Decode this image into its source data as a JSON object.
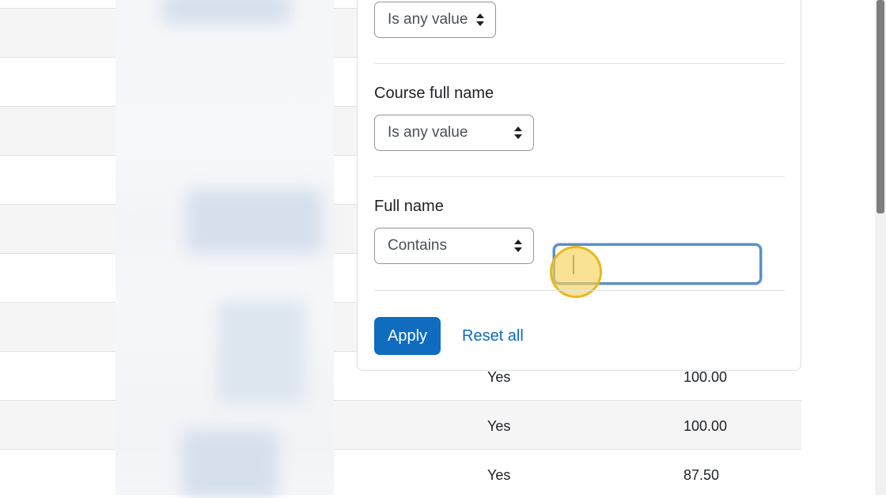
{
  "table": {
    "rows": [
      {
        "status": "",
        "grade": ""
      },
      {
        "status": "",
        "grade": ""
      },
      {
        "status": "",
        "grade": ""
      },
      {
        "status": "",
        "grade": ""
      },
      {
        "status": "",
        "grade": ""
      },
      {
        "status": "",
        "grade": ""
      },
      {
        "status": "",
        "grade": ""
      },
      {
        "status": "Yes",
        "grade": "100.00"
      },
      {
        "status": "Yes",
        "grade": "100.00"
      },
      {
        "status": "Yes",
        "grade": "87.50"
      }
    ]
  },
  "filters": {
    "first": {
      "select_value": "Is any value"
    },
    "course_full_name": {
      "label": "Course full name",
      "select_value": "Is any value"
    },
    "full_name": {
      "label": "Full name",
      "select_value": "Contains",
      "input_value": ""
    }
  },
  "actions": {
    "apply_label": "Apply",
    "reset_label": "Reset all"
  },
  "colors": {
    "accent": "#0f6cbf",
    "focus_ring": "#5b8fc9",
    "cursor_highlight": "#f6d25a"
  }
}
